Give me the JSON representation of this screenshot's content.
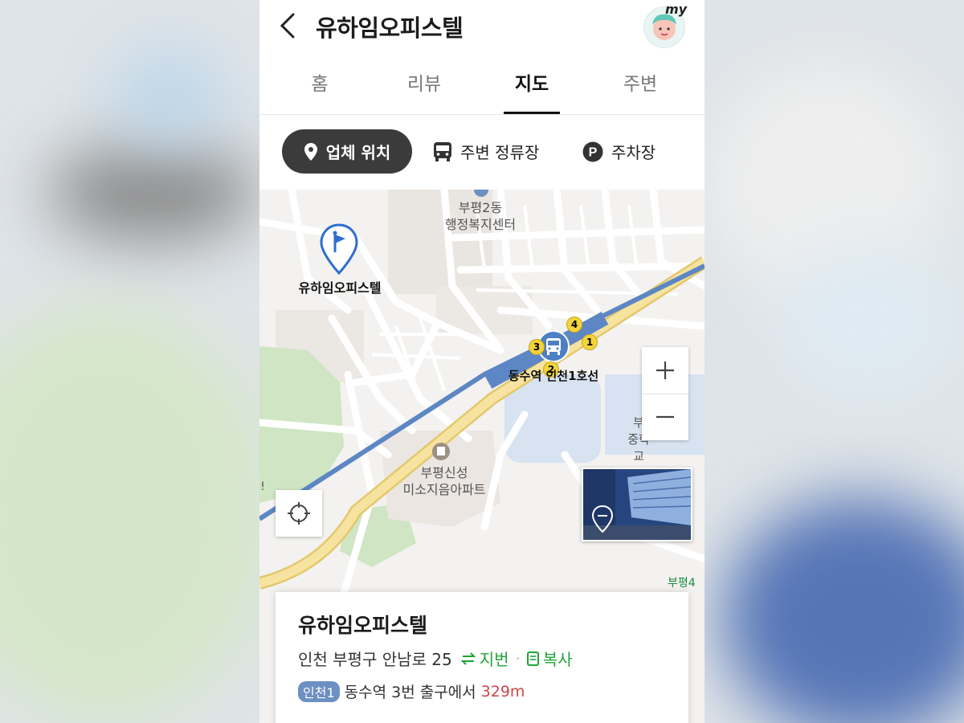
{
  "header": {
    "title": "유하임오피스텔",
    "avatar_badge": "my"
  },
  "tabs": [
    {
      "label": "홈",
      "active": false
    },
    {
      "label": "리뷰",
      "active": false
    },
    {
      "label": "지도",
      "active": true
    },
    {
      "label": "주변",
      "active": false
    }
  ],
  "filters": [
    {
      "label": "업체 위치",
      "icon": "location-pin-icon",
      "active": true
    },
    {
      "label": "주변 정류장",
      "icon": "bus-icon",
      "active": false
    },
    {
      "label": "주차장",
      "icon": "parking-icon",
      "active": false
    }
  ],
  "map": {
    "labels": {
      "community_center": "부평2동\n행정복지센터",
      "place_marker": "유하임오피스텔",
      "station": "동수역 인천1호선",
      "apartment": "부평신성\n미소지음아파트",
      "school": "부\n중학교",
      "edge_right": "부평4",
      "edge_left": "!"
    },
    "exit_numbers": [
      "4",
      "3",
      "1",
      "2"
    ],
    "colors": {
      "rail": "#5d87c4",
      "highway": "#f1d27a",
      "park": "#cfe5c3",
      "school_area": "#d7e3f1"
    }
  },
  "card": {
    "name": "유하임오피스텔",
    "address": "인천 부평구 안남로 25",
    "jibun_label": "지번",
    "copy_label": "복사",
    "line_badge": "인천1",
    "route_text": "동수역 3번 출구에서",
    "distance": "329m"
  }
}
